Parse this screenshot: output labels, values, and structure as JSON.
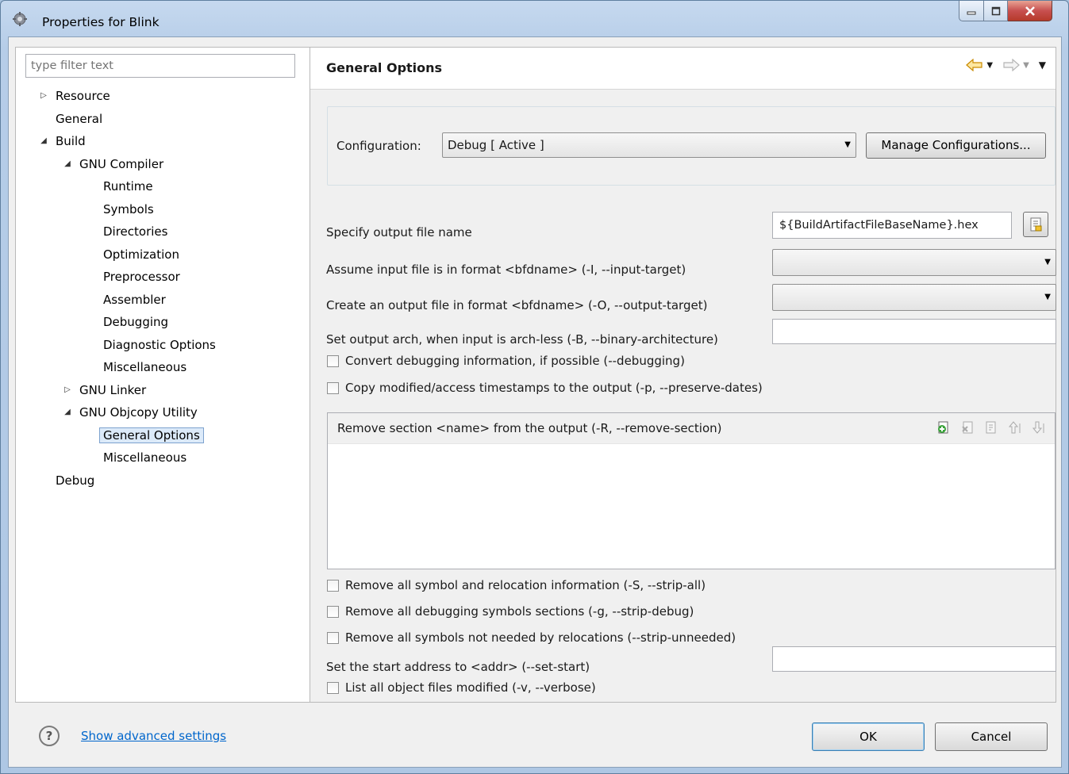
{
  "window": {
    "title": "Properties for Blink"
  },
  "left": {
    "filter_placeholder": "type filter text",
    "tree": [
      {
        "label": "Resource",
        "twisty": "▷",
        "level": 0
      },
      {
        "label": "General",
        "twisty": "",
        "level": 0
      },
      {
        "label": "Build",
        "twisty": "◢",
        "level": 0
      },
      {
        "label": "GNU Compiler",
        "twisty": "◢",
        "level": 1
      },
      {
        "label": "Runtime",
        "twisty": "",
        "level": 2
      },
      {
        "label": "Symbols",
        "twisty": "",
        "level": 2
      },
      {
        "label": "Directories",
        "twisty": "",
        "level": 2
      },
      {
        "label": "Optimization",
        "twisty": "",
        "level": 2
      },
      {
        "label": "Preprocessor",
        "twisty": "",
        "level": 2
      },
      {
        "label": "Assembler",
        "twisty": "",
        "level": 2
      },
      {
        "label": "Debugging",
        "twisty": "",
        "level": 2
      },
      {
        "label": "Diagnostic Options",
        "twisty": "",
        "level": 2
      },
      {
        "label": "Miscellaneous",
        "twisty": "",
        "level": 2
      },
      {
        "label": "GNU Linker",
        "twisty": "▷",
        "level": 1
      },
      {
        "label": "GNU Objcopy Utility",
        "twisty": "◢",
        "level": 1
      },
      {
        "label": "General Options",
        "twisty": "",
        "level": 2,
        "selected": true
      },
      {
        "label": "Miscellaneous",
        "twisty": "",
        "level": 2
      },
      {
        "label": "Debug",
        "twisty": "",
        "level": 0
      }
    ]
  },
  "right": {
    "title": "General Options",
    "config_label": "Configuration:",
    "config_value": "Debug  [ Active ]",
    "manage_button": "Manage Configurations...",
    "output_name_label": "Specify output file name",
    "output_name_value": "${BuildArtifactFileBaseName}.hex",
    "input_format_label": "Assume input file is in format <bfdname> (-I, --input-target)",
    "input_format_value": "",
    "output_format_label": "Create an output file in format <bfdname> (-O, --output-target)",
    "output_format_value": "",
    "arch_label": "Set output arch, when input is arch-less (-B, --binary-architecture)",
    "arch_value": "",
    "cb_debugging": "Convert debugging information, if possible (--debugging)",
    "cb_preserve": "Copy modified/access timestamps to the output (-p, --preserve-dates)",
    "remove_section_label": "Remove section <name> from the output (-R, --remove-section)",
    "cb_strip_all": "Remove all symbol and relocation information (-S, --strip-all)",
    "cb_strip_debug": "Remove all debugging symbols  sections (-g, --strip-debug)",
    "cb_strip_unneeded": "Remove all symbols not needed by relocations (--strip-unneeded)",
    "start_addr_label": "Set the start address to <addr> (--set-start)",
    "start_addr_value": "",
    "cb_verbose": "List all object files modified (-v, --verbose)"
  },
  "bottom": {
    "help": "?",
    "advanced_link": "Show advanced settings",
    "ok": "OK",
    "cancel": "Cancel"
  },
  "colors": {
    "link": "#0066cc",
    "selection_bg": "#dceaf9",
    "selection_border": "#7da2ce",
    "nav_arrow": "#e0a020"
  }
}
